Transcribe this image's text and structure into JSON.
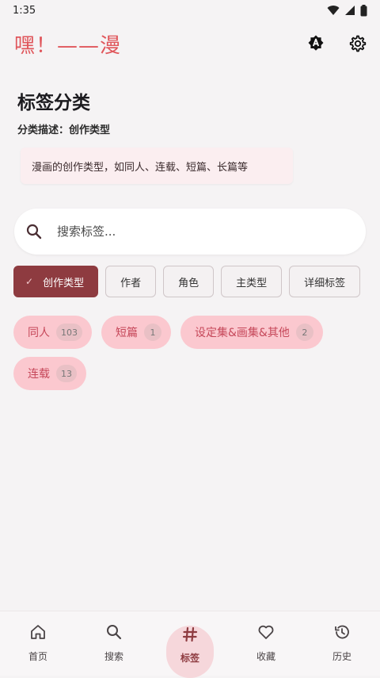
{
  "status": {
    "time": "1:35"
  },
  "app": {
    "title": "嘿！——漫"
  },
  "page": {
    "title": "标签分类",
    "description_line": "分类描述：创作类型",
    "description_card": "漫画的创作类型，如同人、连载、短篇、长篇等"
  },
  "search": {
    "placeholder": "搜索标签..."
  },
  "filters": [
    {
      "label": "创作类型",
      "active": true
    },
    {
      "label": "作者",
      "active": false
    },
    {
      "label": "角色",
      "active": false
    },
    {
      "label": "主类型",
      "active": false
    },
    {
      "label": "详细标签",
      "active": false
    }
  ],
  "tags": [
    {
      "label": "同人",
      "count": "103"
    },
    {
      "label": "短篇",
      "count": "1"
    },
    {
      "label": "设定集&画集&其他",
      "count": "2"
    },
    {
      "label": "连载",
      "count": "13"
    }
  ],
  "nav": [
    {
      "label": "首页",
      "icon": "home-icon"
    },
    {
      "label": "搜索",
      "icon": "search-icon"
    },
    {
      "label": "标签",
      "icon": "hashtag-icon",
      "active": true
    },
    {
      "label": "收藏",
      "icon": "heart-icon"
    },
    {
      "label": "历史",
      "icon": "history-icon"
    }
  ],
  "colors": {
    "accent": "#8e3b40",
    "title": "#e0565b",
    "tag_bg": "#fbc8cf"
  }
}
